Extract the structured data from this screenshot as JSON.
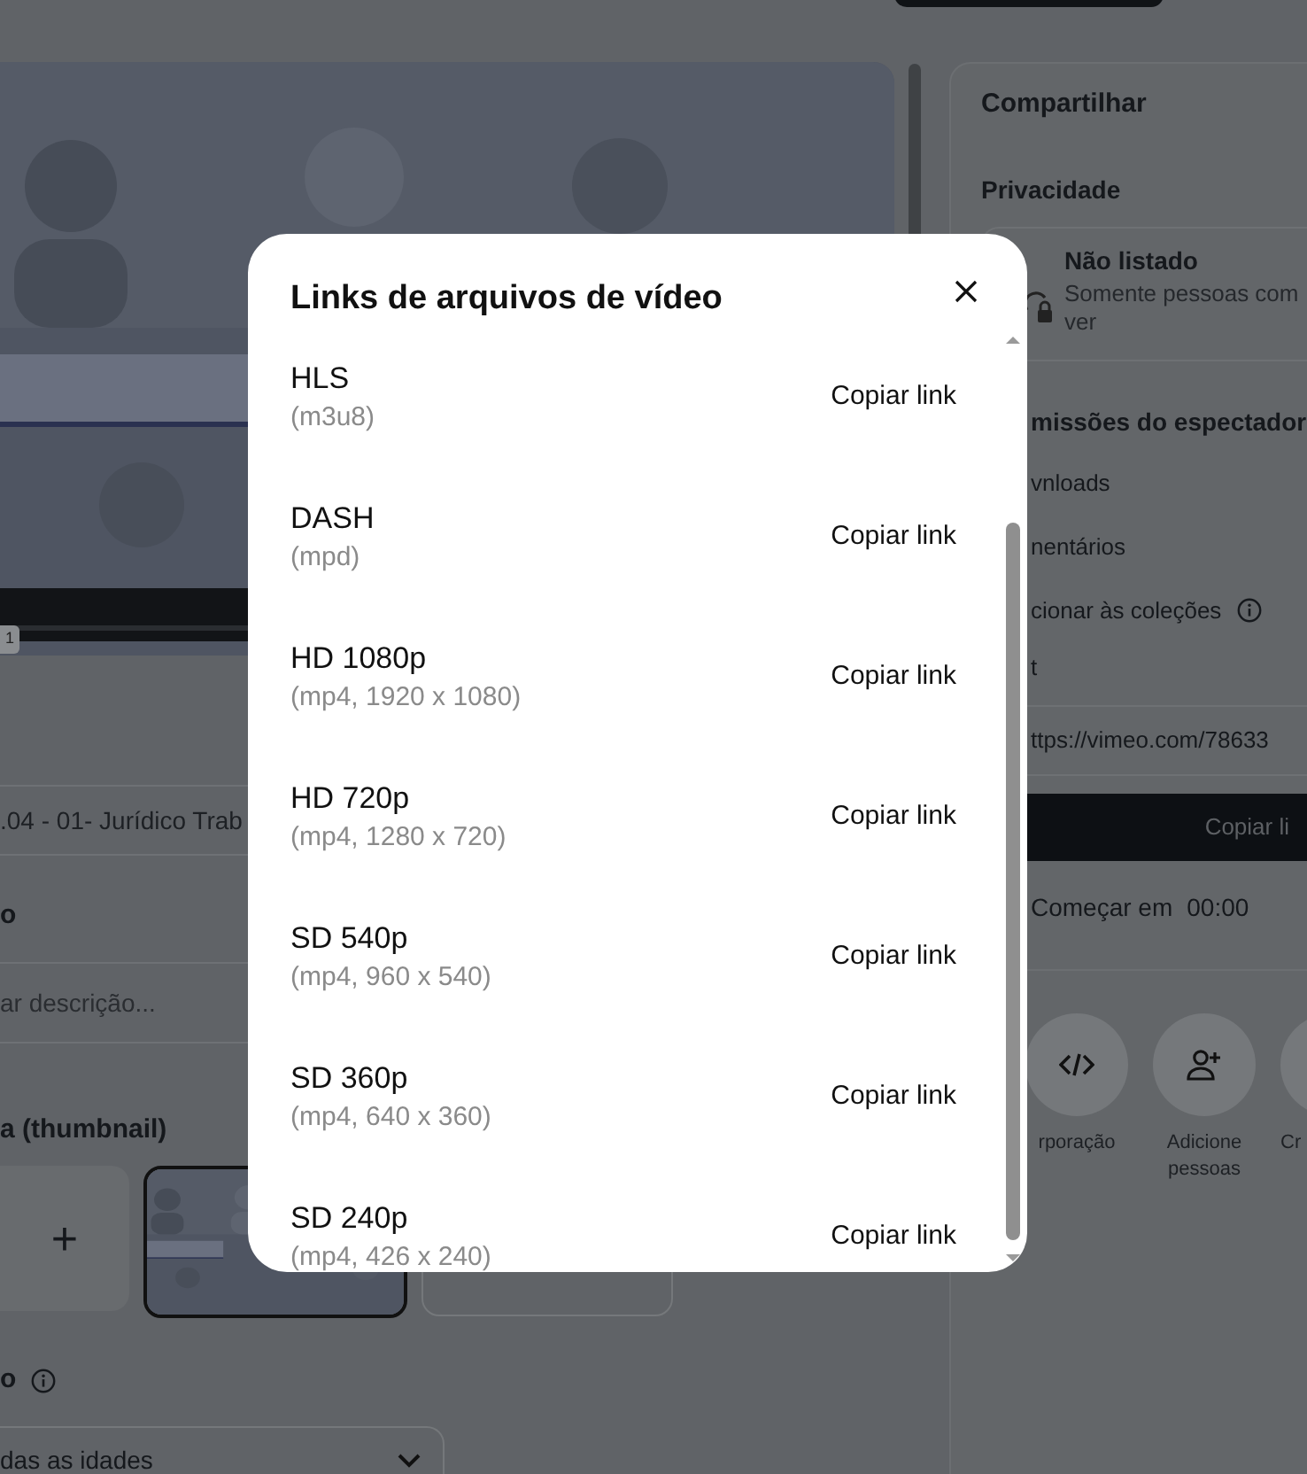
{
  "video_player": {
    "kind": "picture",
    "time_badge": "1"
  },
  "title_field": {
    "value": ".04 - 01- Jurídico Trab"
  },
  "description": {
    "label": "o",
    "placeholder": "ar descrição..."
  },
  "thumbnail": {
    "label": "a (thumbnail)",
    "add_button": "+",
    "options": [
      {
        "kind": "picture",
        "selected": true
      },
      {
        "kind": "empty",
        "selected": false
      }
    ]
  },
  "audience": {
    "label": "o",
    "select_value": "das as idades"
  },
  "share_panel": {
    "title": "Compartilhar",
    "privacy_label": "Privacidade",
    "privacy": {
      "title": "Não listado",
      "description": "Somente pessoas com ver"
    },
    "permissions_label": "missões do espectador",
    "permissions": [
      {
        "label": "vnloads",
        "kind": "plain"
      },
      {
        "label": "nentários",
        "kind": "plain"
      },
      {
        "label": "cionar às coleções",
        "kind": "info"
      }
    ],
    "section_label": "t",
    "link_field": "ttps://vimeo.com/78633",
    "copy_button": "Copiar li",
    "start_at": {
      "label": "Começar em",
      "time": "00:00"
    },
    "actions": [
      {
        "label": "rporação",
        "kind": "code"
      },
      {
        "label": "Adicione pessoas",
        "kind": "person_add"
      },
      {
        "label": "Cr",
        "kind": "other"
      }
    ]
  },
  "modal": {
    "title": "Links de arquivos de vídeo",
    "files": [
      {
        "name": "HLS",
        "detail": "(m3u8)",
        "action": "Copiar link"
      },
      {
        "name": "DASH",
        "detail": "(mpd)",
        "action": "Copiar link"
      },
      {
        "name": "HD 1080p",
        "detail": "(mp4, 1920 x 1080)",
        "action": "Copiar link"
      },
      {
        "name": "HD 720p",
        "detail": "(mp4, 1280 x 720)",
        "action": "Copiar link"
      },
      {
        "name": "SD 540p",
        "detail": "(mp4, 960 x 540)",
        "action": "Copiar link"
      },
      {
        "name": "SD 360p",
        "detail": "(mp4, 640 x 360)",
        "action": "Copiar link"
      },
      {
        "name": "SD 240p",
        "detail": "(mp4, 426 x 240)",
        "action": "Copiar link"
      }
    ]
  }
}
